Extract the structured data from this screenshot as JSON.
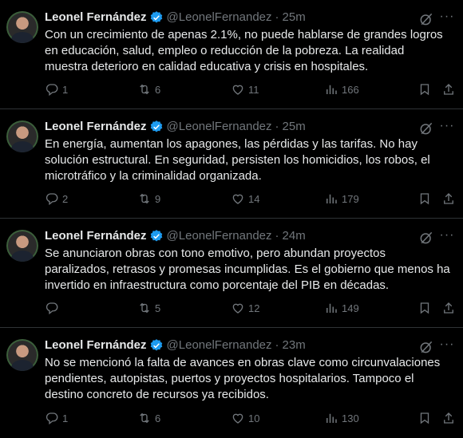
{
  "colors": {
    "background": "#000000",
    "text": "#e7e9ea",
    "muted": "#71767b",
    "verified": "#1d9bf0",
    "divider": "#2f3336"
  },
  "tweets": [
    {
      "name": "Leonel Fernández",
      "handle": "@LeonelFernandez",
      "dot": "·",
      "time": "25m",
      "text": "Con un crecimiento de apenas 2.1%, no puede hablarse de grandes logros\nen educación, salud, empleo o reducción de la pobreza. La realidad\nmuestra deterioro en calidad educativa y crisis en hospitales.",
      "replies": "1",
      "reposts": "6",
      "likes": "11",
      "views": "166"
    },
    {
      "name": "Leonel Fernández",
      "handle": "@LeonelFernandez",
      "dot": "·",
      "time": "25m",
      "text": "En energía, aumentan los apagones, las pérdidas y las tarifas. No hay\nsolución estructural. En seguridad, persisten los homicidios, los robos, el\nmicrotráfico y la criminalidad organizada.",
      "replies": "2",
      "reposts": "9",
      "likes": "14",
      "views": "179"
    },
    {
      "name": "Leonel Fernández",
      "handle": "@LeonelFernandez",
      "dot": "·",
      "time": "24m",
      "text": "Se anunciaron obras con tono emotivo, pero abundan proyectos\nparalizados, retrasos y promesas incumplidas. Es el gobierno que menos ha\ninvertido en infraestructura como porcentaje del PIB en décadas.",
      "replies": "",
      "reposts": "5",
      "likes": "12",
      "views": "149"
    },
    {
      "name": "Leonel Fernández",
      "handle": "@LeonelFernandez",
      "dot": "·",
      "time": "23m",
      "text": "No se mencionó la falta de avances en obras clave como circunvalaciones\npendientes, autopistas, puertos y proyectos hospitalarios. Tampoco el\ndestino concreto de recursos ya recibidos.",
      "replies": "1",
      "reposts": "6",
      "likes": "10",
      "views": "130"
    }
  ],
  "icons": {
    "reply": "reply-icon",
    "repost": "repost-icon",
    "like": "heart-icon",
    "views": "views-icon",
    "bookmark": "bookmark-icon",
    "share": "share-icon",
    "grok": "grok-icon",
    "more": "more-icon",
    "verified": "verified-badge-icon"
  }
}
